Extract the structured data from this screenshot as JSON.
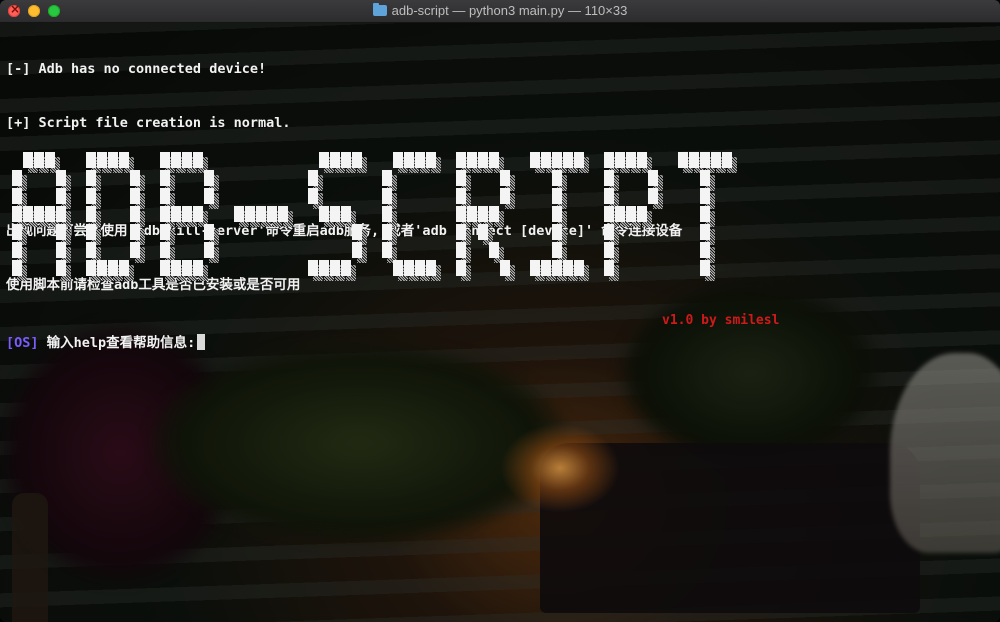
{
  "window": {
    "title": "adb-script — python3 main.py — 110×33",
    "folder_icon": "folder-icon"
  },
  "terminal": {
    "lines": [
      "[-] Adb has no connected device!",
      "[+] Script file creation is normal.",
      "出现问题可尝试使用'adb kill-server'命令重启adb服务, 或者'adb connect [device]' 命令连接设备",
      "使用脚本前请检查adb工具是否已安装或是否可用"
    ],
    "banner_text": "ADB-SCRIPT",
    "version": "v1.0 by smilesl",
    "prompt_tag": "[OS]",
    "prompt_text": "输入help查看帮助信息:"
  },
  "colors": {
    "text": "#f2f2f2",
    "prompt_tag": "#7b5cff",
    "version": "#d01a1a",
    "close": "#fe5f57",
    "minimize": "#febc2e",
    "maximize": "#28c840"
  }
}
